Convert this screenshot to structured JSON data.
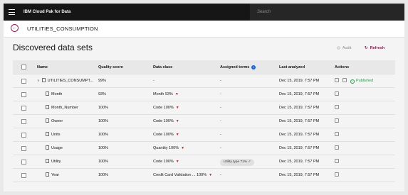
{
  "header": {
    "brand": "IBM Cloud Pak for Data",
    "search_placeholder": "Search"
  },
  "breadcrumb": {
    "title": "UTILITIES_CONSUMPTION"
  },
  "page": {
    "title": "Discovered data sets",
    "audit_label": "Audit",
    "refresh_label": "Refresh"
  },
  "table": {
    "columns": {
      "name": "Name",
      "quality": "Quality score",
      "data_class": "Data class",
      "assigned_terms": "Assigned terms",
      "last_analyzed": "Last analyzed",
      "actions": "Actions"
    },
    "rows": [
      {
        "name": "UTILITIES_CONSUMPT...",
        "quality": "99%",
        "data_class": "-",
        "assigned_terms": "-",
        "last_analyzed": "Dec 15, 2019, 7:57 PM",
        "status": "Published"
      },
      {
        "name": "Month",
        "quality": "93%",
        "data_class": "Month 93%",
        "assigned_terms": "-",
        "last_analyzed": "Dec 15, 2019, 7:57 PM"
      },
      {
        "name": "Month_Number",
        "quality": "100%",
        "data_class": "Code 100%",
        "assigned_terms": "-",
        "last_analyzed": "Dec 15, 2019, 7:57 PM"
      },
      {
        "name": "Owner",
        "quality": "100%",
        "data_class": "Code 100%",
        "assigned_terms": "-",
        "last_analyzed": "Dec 15, 2019, 7:57 PM"
      },
      {
        "name": "Units",
        "quality": "100%",
        "data_class": "Code 100%",
        "assigned_terms": "-",
        "last_analyzed": "Dec 15, 2019, 7:57 PM"
      },
      {
        "name": "Usage",
        "quality": "100%",
        "data_class": "Quantity 100%",
        "assigned_terms": "-",
        "last_analyzed": "Dec 15, 2019, 7:57 PM"
      },
      {
        "name": "Utility",
        "quality": "100%",
        "data_class": "Code 100%",
        "assigned_terms": "Utility type  71%",
        "last_analyzed": "Dec 15, 2019, 7:57 PM"
      },
      {
        "name": "Year",
        "quality": "100%",
        "data_class": "Credit Card Validation ... 100%",
        "assigned_terms": "-",
        "last_analyzed": "Dec 15, 2019, 7:57 PM"
      }
    ]
  },
  "colors": {
    "accent": "#9f1853",
    "published": "#24a148",
    "caret": "#da1e28",
    "info": "#0f62fe"
  },
  "icons": [
    "menu-icon",
    "back-arrow-icon",
    "audit-icon",
    "refresh-icon",
    "info-icon",
    "file-icon",
    "chevron-down-icon",
    "caret-down-icon",
    "edit-icon",
    "publish-icon",
    "checkmark-icon"
  ]
}
